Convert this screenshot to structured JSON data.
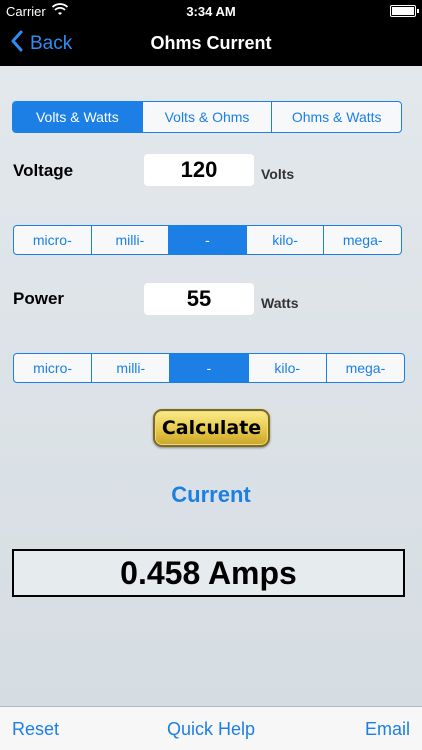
{
  "status": {
    "carrier": "Carrier",
    "time": "3:34 AM"
  },
  "nav": {
    "back_label": "Back",
    "title": "Ohms Current"
  },
  "mode_tabs": [
    {
      "label": "Volts & Watts",
      "selected": true
    },
    {
      "label": "Volts & Ohms",
      "selected": false
    },
    {
      "label": "Ohms & Watts",
      "selected": false
    }
  ],
  "voltage": {
    "label": "Voltage",
    "value": "120",
    "unit": "Volts",
    "prefixes": [
      {
        "label": "micro-",
        "selected": false
      },
      {
        "label": "milli-",
        "selected": false
      },
      {
        "label": "-",
        "selected": true
      },
      {
        "label": "kilo-",
        "selected": false
      },
      {
        "label": "mega-",
        "selected": false
      }
    ]
  },
  "power": {
    "label": "Power",
    "value": "55",
    "unit": "Watts",
    "prefixes": [
      {
        "label": "micro-",
        "selected": false
      },
      {
        "label": "milli-",
        "selected": false
      },
      {
        "label": "-",
        "selected": true
      },
      {
        "label": "kilo-",
        "selected": false
      },
      {
        "label": "mega-",
        "selected": false
      }
    ]
  },
  "calculate_label": "Calculate",
  "result": {
    "title": "Current",
    "value": "0.458 Amps"
  },
  "toolbar": {
    "reset_label": "Reset",
    "help_label": "Quick Help",
    "email_label": "Email"
  },
  "colors": {
    "accent": "#1b7fe5",
    "nav_background": "#000000",
    "calculate_button": "#e8c949"
  }
}
